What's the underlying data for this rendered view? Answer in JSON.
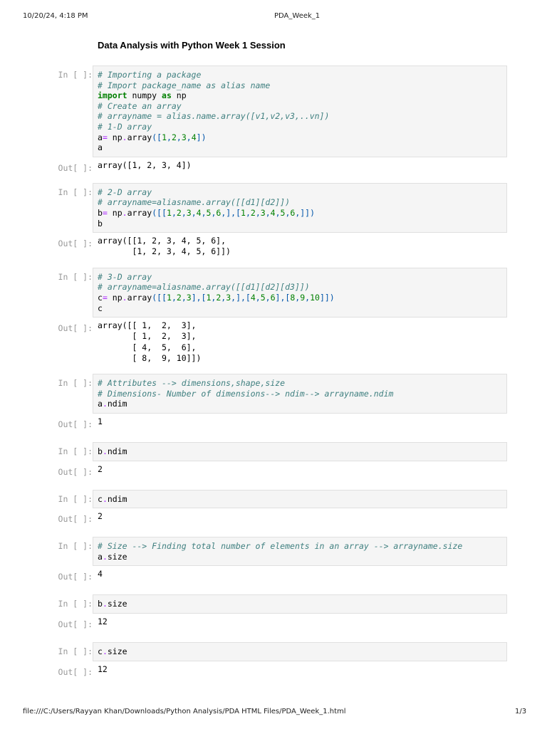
{
  "header": {
    "datetime": "10/20/24, 4:18 PM",
    "doc_title": "PDA_Week_1"
  },
  "footer": {
    "path": "file:///C:/Users/Rayyan Khan/Downloads/Python Analysis/PDA HTML Files/PDA_Week_1.html",
    "page": "1/3"
  },
  "title": "Data Analysis with Python Week 1 Session",
  "prompts": {
    "in": "In [ ]:",
    "out": "Out[ ]:"
  },
  "cells": [
    {
      "code": [
        [
          [
            "c",
            "# Importing a package"
          ]
        ],
        [
          [
            "c",
            "# Import package_name as alias name"
          ]
        ],
        [
          [
            "k",
            "import"
          ],
          [
            "x",
            " numpy "
          ],
          [
            "k",
            "as"
          ],
          [
            "x",
            " np"
          ]
        ],
        [
          [
            "c",
            "# Create an array"
          ]
        ],
        [
          [
            "c",
            "# arrayname = alias.name.array([v1,v2,v3,..vn])"
          ]
        ],
        [
          [
            "c",
            "# 1-D array"
          ]
        ],
        [
          [
            "x",
            "a"
          ],
          [
            "o",
            "="
          ],
          [
            "x",
            " np"
          ],
          [
            "o",
            "."
          ],
          [
            "x",
            "array"
          ],
          [
            "p",
            "(["
          ],
          [
            "n",
            "1"
          ],
          [
            "p",
            ","
          ],
          [
            "n",
            "2"
          ],
          [
            "p",
            ","
          ],
          [
            "n",
            "3"
          ],
          [
            "p",
            ","
          ],
          [
            "n",
            "4"
          ],
          [
            "p",
            "])"
          ]
        ],
        [
          [
            "x",
            "a"
          ]
        ]
      ],
      "output": "array([1, 2, 3, 4])"
    },
    {
      "code": [
        [
          [
            "c",
            "# 2-D array"
          ]
        ],
        [
          [
            "c",
            "# arrayname=aliasname.array([[d1][d2]])"
          ]
        ],
        [
          [
            "x",
            "b"
          ],
          [
            "o",
            "="
          ],
          [
            "x",
            " np"
          ],
          [
            "o",
            "."
          ],
          [
            "x",
            "array"
          ],
          [
            "p",
            "([["
          ],
          [
            "n",
            "1"
          ],
          [
            "p",
            ","
          ],
          [
            "n",
            "2"
          ],
          [
            "p",
            ","
          ],
          [
            "n",
            "3"
          ],
          [
            "p",
            ","
          ],
          [
            "n",
            "4"
          ],
          [
            "p",
            ","
          ],
          [
            "n",
            "5"
          ],
          [
            "p",
            ","
          ],
          [
            "n",
            "6"
          ],
          [
            "p",
            ",],["
          ],
          [
            "n",
            "1"
          ],
          [
            "p",
            ","
          ],
          [
            "n",
            "2"
          ],
          [
            "p",
            ","
          ],
          [
            "n",
            "3"
          ],
          [
            "p",
            ","
          ],
          [
            "n",
            "4"
          ],
          [
            "p",
            ","
          ],
          [
            "n",
            "5"
          ],
          [
            "p",
            ","
          ],
          [
            "n",
            "6"
          ],
          [
            "p",
            ",]])"
          ]
        ],
        [
          [
            "x",
            "b"
          ]
        ]
      ],
      "output": "array([[1, 2, 3, 4, 5, 6],\n       [1, 2, 3, 4, 5, 6]])"
    },
    {
      "code": [
        [
          [
            "c",
            "# 3-D array"
          ]
        ],
        [
          [
            "c",
            "# arrayname=aliasname.array([[d1][d2][d3]])"
          ]
        ],
        [
          [
            "x",
            "c"
          ],
          [
            "o",
            "="
          ],
          [
            "x",
            " np"
          ],
          [
            "o",
            "."
          ],
          [
            "x",
            "array"
          ],
          [
            "p",
            "([["
          ],
          [
            "n",
            "1"
          ],
          [
            "p",
            ","
          ],
          [
            "n",
            "2"
          ],
          [
            "p",
            ","
          ],
          [
            "n",
            "3"
          ],
          [
            "p",
            "],["
          ],
          [
            "n",
            "1"
          ],
          [
            "p",
            ","
          ],
          [
            "n",
            "2"
          ],
          [
            "p",
            ","
          ],
          [
            "n",
            "3"
          ],
          [
            "p",
            ",],["
          ],
          [
            "n",
            "4"
          ],
          [
            "p",
            ","
          ],
          [
            "n",
            "5"
          ],
          [
            "p",
            ","
          ],
          [
            "n",
            "6"
          ],
          [
            "p",
            "],["
          ],
          [
            "n",
            "8"
          ],
          [
            "p",
            ","
          ],
          [
            "n",
            "9"
          ],
          [
            "p",
            ","
          ],
          [
            "n",
            "10"
          ],
          [
            "p",
            "]])"
          ]
        ],
        [
          [
            "x",
            "c"
          ]
        ]
      ],
      "output": "array([[ 1,  2,  3],\n       [ 1,  2,  3],\n       [ 4,  5,  6],\n       [ 8,  9, 10]])"
    },
    {
      "code": [
        [
          [
            "c",
            "# Attributes --> dimensions,shape,size"
          ]
        ],
        [
          [
            "c",
            "# Dimensions- Number of dimensions--> ndim--> arrayname.ndim"
          ]
        ],
        [
          [
            "x",
            "a"
          ],
          [
            "o",
            "."
          ],
          [
            "x",
            "ndim"
          ]
        ]
      ],
      "output": "1"
    },
    {
      "code": [
        [
          [
            "x",
            "b"
          ],
          [
            "o",
            "."
          ],
          [
            "x",
            "ndim"
          ]
        ]
      ],
      "output": "2"
    },
    {
      "code": [
        [
          [
            "x",
            "c"
          ],
          [
            "o",
            "."
          ],
          [
            "x",
            "ndim"
          ]
        ]
      ],
      "output": "2"
    },
    {
      "code": [
        [
          [
            "c",
            "# Size --> Finding total number of elements in an array --> arrayname.size"
          ]
        ],
        [
          [
            "x",
            "a"
          ],
          [
            "o",
            "."
          ],
          [
            "x",
            "size"
          ]
        ]
      ],
      "output": "4"
    },
    {
      "code": [
        [
          [
            "x",
            "b"
          ],
          [
            "o",
            "."
          ],
          [
            "x",
            "size"
          ]
        ]
      ],
      "output": "12"
    },
    {
      "code": [
        [
          [
            "x",
            "c"
          ],
          [
            "o",
            "."
          ],
          [
            "x",
            "size"
          ]
        ]
      ],
      "output": "12"
    }
  ]
}
